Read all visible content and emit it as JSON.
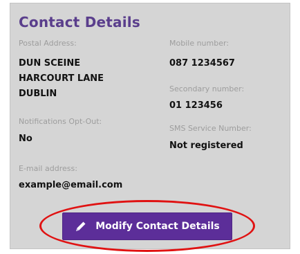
{
  "panel": {
    "title": "Contact Details",
    "postal": {
      "label": "Postal Address:",
      "lines": [
        "DUN SCEINE",
        "HARCOURT LANE",
        "DUBLIN"
      ]
    },
    "notifications": {
      "label": "Notifications Opt-Out:",
      "value": "No"
    },
    "email": {
      "label": "E-mail address:",
      "value": "example@email.com"
    },
    "mobile": {
      "label": "Mobile number:",
      "value": "087 1234567"
    },
    "secondary": {
      "label": "Secondary number:",
      "value": "01 123456"
    },
    "sms": {
      "label": "SMS Service Number:",
      "value": "Not registered"
    },
    "modify_button": {
      "label": "Modify Contact Details",
      "icon": "pencil-icon"
    }
  },
  "colors": {
    "accent": "#5c2e99",
    "title": "#5a3e8c",
    "panel_bg": "#d5d5d5",
    "highlight": "#e01212"
  }
}
